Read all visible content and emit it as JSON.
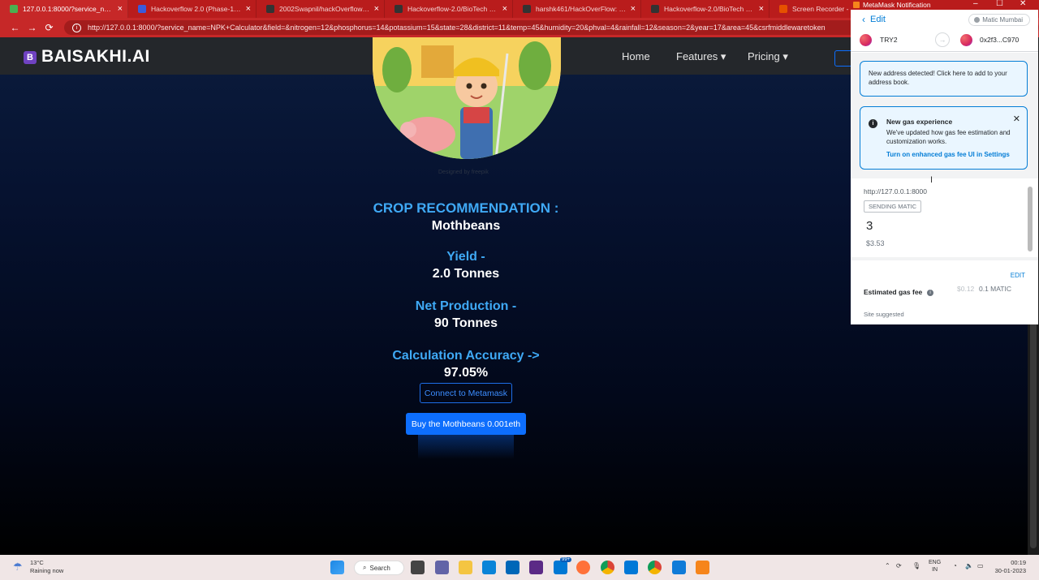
{
  "browser": {
    "tabs": [
      {
        "title": "127.0.0.1:8000/?service_name=N",
        "color": "#4caf50",
        "active": true
      },
      {
        "title": "Hackoverflow 2.0 (Phase-1) | Dev",
        "color": "#3b5bdb"
      },
      {
        "title": "2002Swapnil/hackOverflow_2.0",
        "color": "#333333"
      },
      {
        "title": "Hackoverflow-2.0/BioTech at ma",
        "color": "#333333"
      },
      {
        "title": "harshk461/HackOverFlow: Pratic",
        "color": "#333333"
      },
      {
        "title": "Hackoverflow-2.0/BioTech at ma",
        "color": "#333333"
      },
      {
        "title": "Screen Recorder - Chro",
        "color": "#e65100"
      }
    ],
    "url_host": "127.0.0.1",
    "url": "http://127.0.0.1:8000/?service_name=NPK+Calculator&field=&nitrogen=12&phosphorus=14&potassium=15&state=28&district=11&temp=45&humidity=20&phval=4&rainfall=12&season=2&year=17&area=45&csrfmiddlewaretoken"
  },
  "site": {
    "brand_letter": "B",
    "brand": "BAISAKHI.AI",
    "nav": {
      "home": "Home",
      "features": "Features ▾",
      "pricing": "Pricing ▾"
    },
    "image_credit": "Designed by freepik",
    "results": {
      "crop_label": "CROP RECOMMENDATION :",
      "crop_value": "Mothbeans",
      "yield_label": "Yield -",
      "yield_value": "2.0 Tonnes",
      "production_label": "Net Production -",
      "production_value": "90 Tonnes",
      "accuracy_label": "Calculation Accuracy ->",
      "accuracy_value": "97.05%"
    },
    "connect_button": "Connect to Metamask",
    "buy_button": "Buy the Mothbeans 0.001eth"
  },
  "metamask": {
    "window_title": "MetaMask Notification",
    "back_label": "Edit",
    "network": "Matic Mumbai",
    "from_account": "TRY2",
    "to_account": "0x2f3...C970",
    "notice_address": "New address detected! Click here to add to your address book.",
    "gas_notice": {
      "title": "New gas experience",
      "text": "We've updated how gas fee estimation and customization works.",
      "link": "Turn on enhanced gas fee UI in Settings"
    },
    "origin": "http://127.0.0.1:8000",
    "tx_type": "SENDING MATIC",
    "amount": "3",
    "amount_fiat": "$3.53",
    "edit_label": "EDIT",
    "gas_label": "Estimated gas fee",
    "gas_fiat": "$0.12",
    "gas_crypto": "0.1 MATIC",
    "gas_note": "Site suggested"
  },
  "taskbar": {
    "temperature": "13°C",
    "weather": "Raining now",
    "search": "Search",
    "mail_badge": "99+",
    "lang_top": "ENG",
    "lang_bottom": "IN",
    "time": "00:19",
    "date": "30-01-2023"
  }
}
